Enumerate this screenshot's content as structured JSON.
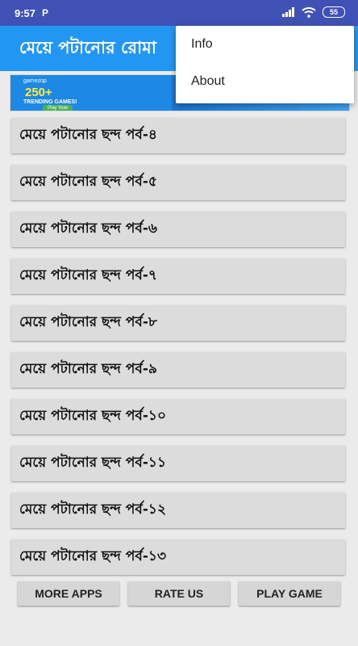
{
  "status_bar": {
    "time": "9:57",
    "notification": "P",
    "battery": "55",
    "icons": [
      "signal-icon",
      "wifi-icon",
      "battery-icon"
    ]
  },
  "app_bar": {
    "title": "মেয়ে পটানোর রোমা"
  },
  "ad": {
    "logo": "gamezop",
    "headline": "250+",
    "subline": "TRENDING GAMES!",
    "cta": "Play Now"
  },
  "items": [
    "মেয়ে পটানোর ছন্দ পর্ব-৪",
    "মেয়ে পটানোর ছন্দ পর্ব-৫",
    "মেয়ে পটানোর ছন্দ পর্ব-৬",
    "মেয়ে পটানোর ছন্দ পর্ব-৭",
    "মেয়ে পটানোর ছন্দ পর্ব-৮",
    "মেয়ে পটানোর ছন্দ পর্ব-৯",
    "মেয়ে পটানোর ছন্দ পর্ব-১০",
    "মেয়ে পটানোর ছন্দ পর্ব-১১",
    "মেয়ে পটানোর ছন্দ পর্ব-১২",
    "মেয়ে পটানোর ছন্দ পর্ব-১৩"
  ],
  "buttons": {
    "more_apps": "MORE APPS",
    "rate_us": "RATE US",
    "play_game": "PLAY GAME"
  },
  "menu": {
    "items": [
      "Info",
      "About"
    ]
  },
  "colors": {
    "status_bar": "#3f51b5",
    "app_bar": "#2196f3",
    "background": "#ebebeb",
    "list_item": "#dcdcdc"
  }
}
